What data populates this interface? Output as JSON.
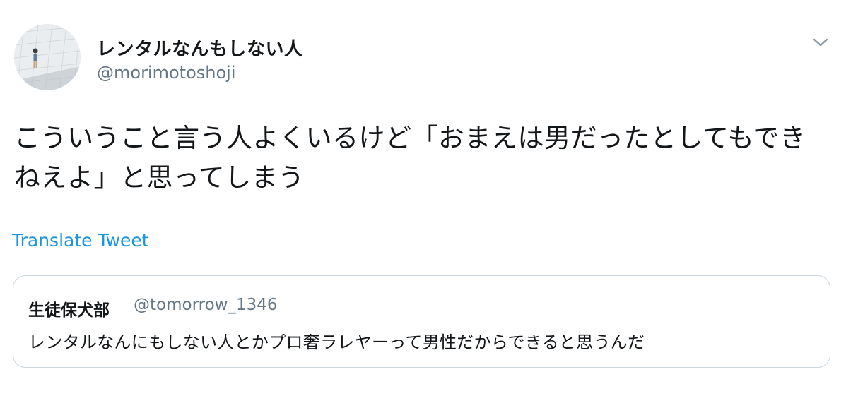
{
  "tweet": {
    "author": {
      "display_name": "レンタルなんもしない人",
      "handle": "@morimotoshoji"
    },
    "text": "こういうこと言う人よくいるけど「おまえは男だったとしてもできねえよ」と思ってしまう",
    "translate_label": "Translate Tweet",
    "menu_icon": "chevron-down-icon"
  },
  "quoted_tweet": {
    "author": {
      "display_name": "生徒保犬部",
      "handle": "@tomorrow_1346"
    },
    "text": "レンタルなんにもしない人とかプロ奢ラレヤーって男性だからできると思うんだ"
  },
  "colors": {
    "text_primary": "#14171a",
    "text_secondary": "#657786",
    "link": "#1b95e0",
    "border": "#ccd6dd"
  }
}
